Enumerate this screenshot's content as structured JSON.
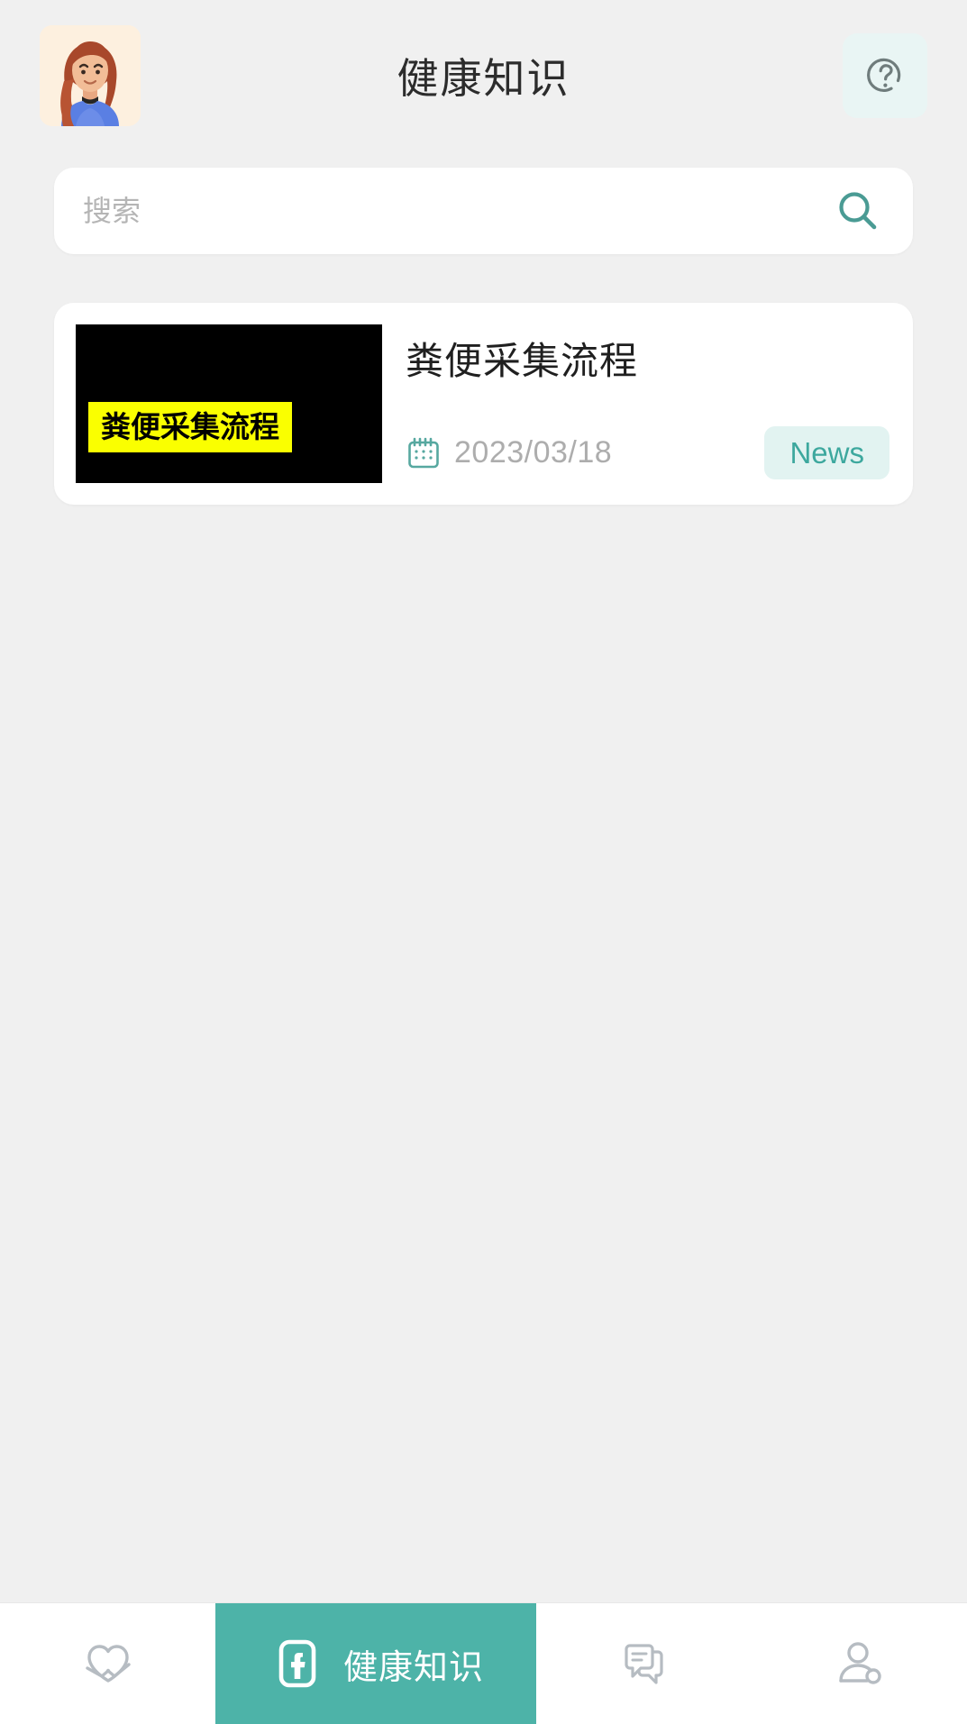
{
  "header": {
    "title": "健康知识",
    "avatar_icon": "user-avatar-illustration",
    "avatar_bg": "#FDF0DF",
    "help_icon": "question-mark-circle-icon",
    "help_bg": "#E9F5F4"
  },
  "search": {
    "placeholder": "搜索",
    "value": "",
    "icon": "search-icon",
    "icon_color": "#4A9B94"
  },
  "articles": [
    {
      "title": "粪便采集流程",
      "thumbnail_text": "粪便采集流程",
      "thumbnail_bg": "#000000",
      "thumbnail_banner_bg": "#FAFF00",
      "date": "2023/03/18",
      "date_icon": "calendar-icon",
      "tag": "News",
      "tag_bg": "#E2F3F1",
      "tag_color": "#3DA89E"
    }
  ],
  "bottom_nav": {
    "active_color": "#4DB3A8",
    "inactive_color": "#B6BCC2",
    "items": [
      {
        "label": "",
        "icon": "heart-pulse-icon",
        "active": false
      },
      {
        "label": "健康知识",
        "icon": "phone-f-icon",
        "active": true
      },
      {
        "label": "",
        "icon": "chat-bubbles-icon",
        "active": false
      },
      {
        "label": "",
        "icon": "user-profile-icon",
        "active": false
      }
    ]
  }
}
